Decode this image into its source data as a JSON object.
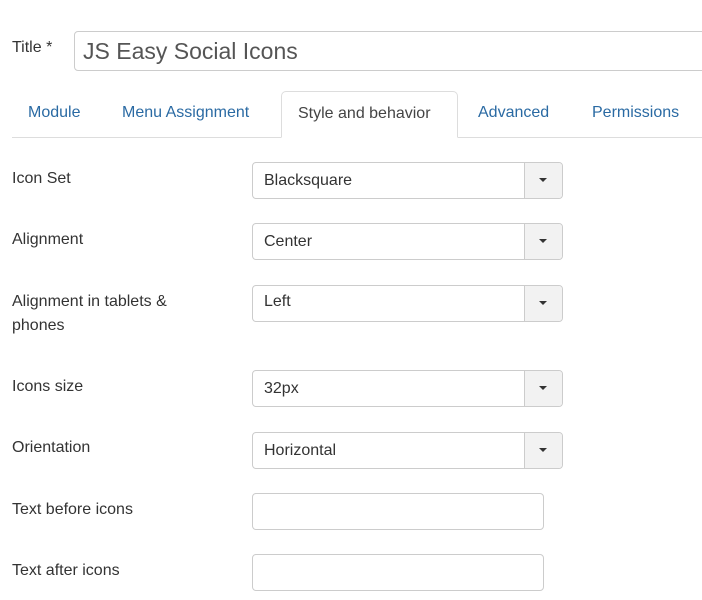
{
  "title": {
    "label": "Title *",
    "value": "JS Easy Social Icons"
  },
  "tabs": [
    {
      "label": "Module",
      "active": false
    },
    {
      "label": "Menu Assignment",
      "active": false
    },
    {
      "label": "Style and behavior",
      "active": true
    },
    {
      "label": "Advanced",
      "active": false
    },
    {
      "label": "Permissions",
      "active": false
    }
  ],
  "fields": {
    "icon_set": {
      "label": "Icon Set",
      "value": "Blacksquare"
    },
    "alignment": {
      "label": "Alignment",
      "value": "Center"
    },
    "alignment_tablets": {
      "label_line1": "Alignment in tablets &",
      "label_line2": "phones",
      "value": "Left"
    },
    "icons_size": {
      "label": "Icons size",
      "value": "32px"
    },
    "orientation": {
      "label": "Orientation",
      "value": "Horizontal"
    },
    "text_before": {
      "label": "Text before icons",
      "value": ""
    },
    "text_after": {
      "label": "Text after icons",
      "value": ""
    }
  },
  "colors": {
    "link": "#2a6aa3",
    "border": "#cccccc"
  }
}
